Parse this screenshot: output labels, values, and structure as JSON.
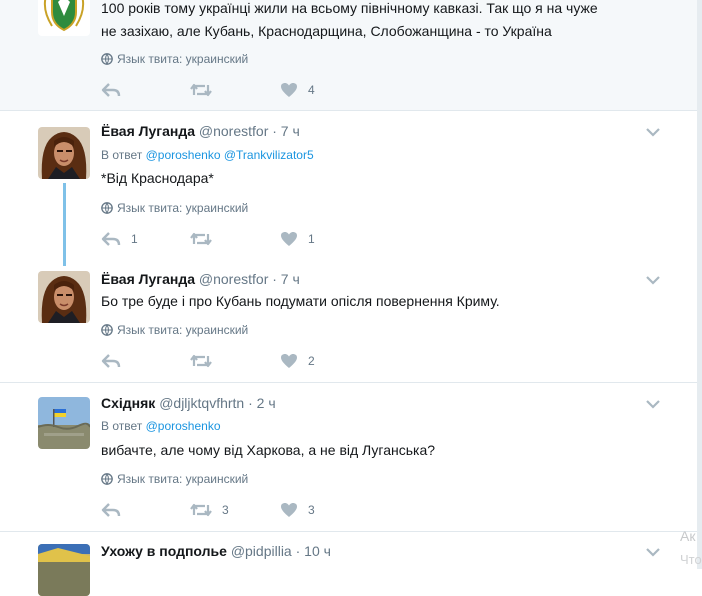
{
  "tweets": [
    {
      "text_lines": [
        "100 років тому українці жили на всьому північному кавказі. Так що я на чуже",
        "не зазіхаю, але Кубань, Краснодарщина, Слобожанщина - то Україна"
      ],
      "lang": "Язык твита: украинский",
      "replies": "",
      "retweets": "",
      "likes": "4"
    },
    {
      "name": "Ёвая Луганда",
      "handle": "@norestfor",
      "time": "· 7 ч",
      "reply_prefix": "В ответ",
      "reply_mentions": [
        "@poroshenko",
        "@Trankvilizator5"
      ],
      "text_lines": [
        "*Від Краснодара*"
      ],
      "lang": "Язык твита: украинский",
      "replies": "1",
      "retweets": "",
      "likes": "1"
    },
    {
      "name": "Ёвая Луганда",
      "handle": "@norestfor",
      "time": "· 7 ч",
      "text_lines": [
        "Бо тре буде і про Кубань подумати опісля повернення Криму."
      ],
      "lang": "Язык твита: украинский",
      "replies": "",
      "retweets": "",
      "likes": "2"
    },
    {
      "name": "Східняк",
      "handle": "@djljktqvfhrtn",
      "time": "· 2 ч",
      "reply_prefix": "В ответ",
      "reply_mentions": [
        "@poroshenko"
      ],
      "text_lines": [
        "вибачте, але чому від Харкова, а не від Луганська?"
      ],
      "lang": "Язык твита: украинский",
      "replies": "",
      "retweets": "3",
      "likes": "3"
    },
    {
      "name": "Ухожу в подполье",
      "handle": "@pidpillia",
      "time": "· 10 ч"
    }
  ],
  "watermark": {
    "line1": "Ак",
    "line2": "Что"
  },
  "colors": {
    "accent": "#1b95e0",
    "muted": "#657786",
    "icon": "#aab8c2",
    "thread_line": "#7fc1e8",
    "highlight_bg": "#f5f8fa"
  },
  "icons": [
    "coat-of-arms-avatar",
    "globe-icon",
    "reply-icon",
    "retweet-icon",
    "like-icon",
    "chevron-down-icon"
  ]
}
